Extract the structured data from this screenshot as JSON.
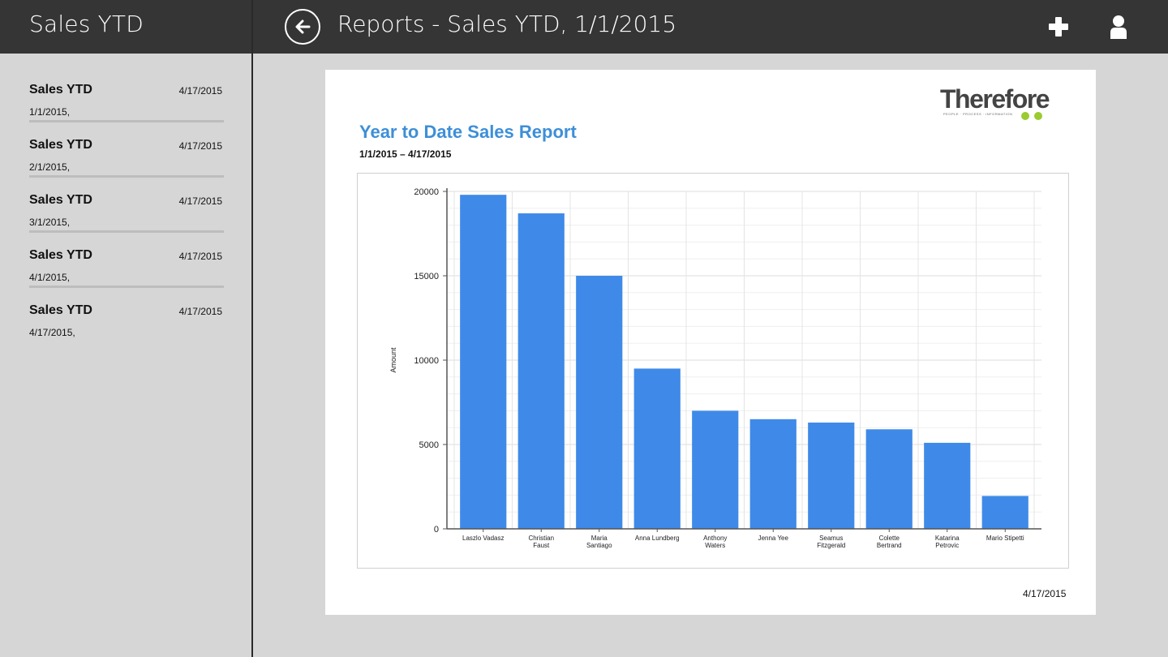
{
  "sidebar": {
    "title": "Sales YTD",
    "items": [
      {
        "name": "Sales YTD",
        "date": "4/17/2015",
        "sub": "1/1/2015,"
      },
      {
        "name": "Sales YTD",
        "date": "4/17/2015",
        "sub": "2/1/2015,"
      },
      {
        "name": "Sales YTD",
        "date": "4/17/2015",
        "sub": "3/1/2015,"
      },
      {
        "name": "Sales YTD",
        "date": "4/17/2015",
        "sub": "4/1/2015,"
      },
      {
        "name": "Sales YTD",
        "date": "4/17/2015",
        "sub": "4/17/2015,"
      }
    ]
  },
  "header": {
    "title": "Reports - Sales YTD, 1/1/2015",
    "icons": [
      "back-arrow-icon",
      "plus-icon",
      "user-icon"
    ]
  },
  "report": {
    "logo_text": "Therefore",
    "logo_tagline": "PEOPLE · PROCESS · INFORMATION",
    "title": "Year to Date Sales Report",
    "range": "1/1/2015 – 4/17/2015",
    "footer_date": "4/17/2015"
  },
  "colors": {
    "header_bg": "#353535",
    "bar": "#3f8ae8",
    "title_blue": "#3d8fd8",
    "logo_dot": "#9acb2f"
  },
  "chart_data": {
    "type": "bar",
    "ylabel": "Amount",
    "xlabel": "",
    "ylim": [
      0,
      20000
    ],
    "yticks": [
      0,
      5000,
      10000,
      15000,
      20000
    ],
    "grid": true,
    "categories": [
      "Laszlo Vadasz",
      "Christian Faust",
      "Maria Santiago",
      "Anna Lundberg",
      "Anthony Waters",
      "Jenna Yee",
      "Seamus Fitzgerald",
      "Colette Bertrand",
      "Katarina Petrovic",
      "Mario Stipetti"
    ],
    "category_lines": [
      [
        "Laszlo Vadasz"
      ],
      [
        "Christian",
        "Faust"
      ],
      [
        "Maria",
        "Santiago"
      ],
      [
        "Anna Lundberg"
      ],
      [
        "Anthony",
        "Waters"
      ],
      [
        "Jenna Yee"
      ],
      [
        "Seamus",
        "Fitzgerald"
      ],
      [
        "Colette",
        "Bertrand"
      ],
      [
        "Katarina",
        "Petrovic"
      ],
      [
        "Mario Stipetti"
      ]
    ],
    "values": [
      19800,
      18700,
      15000,
      9500,
      7000,
      6500,
      6300,
      5900,
      5100,
      1950
    ]
  }
}
